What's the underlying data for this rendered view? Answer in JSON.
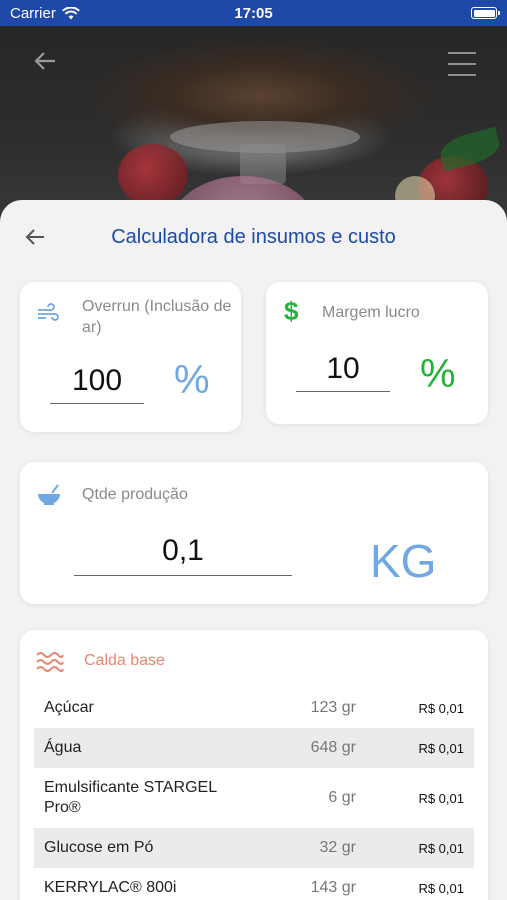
{
  "status_bar": {
    "carrier": "Carrier",
    "time": "17:05"
  },
  "header": {
    "title": "Calculadora de insumos e custo"
  },
  "overrun": {
    "label": "Overrun (Inclusão de ar)",
    "value": "100",
    "unit": "%"
  },
  "margem": {
    "icon": "$",
    "label": "Margem lucro",
    "value": "10",
    "unit": "%"
  },
  "qtde": {
    "label": "Qtde produção",
    "value": "0,1",
    "unit": "KG"
  },
  "calda": {
    "label": "Calda base",
    "items": [
      {
        "name": "Açúcar",
        "qty": "123 gr",
        "price": "R$ 0,01"
      },
      {
        "name": "Água",
        "qty": "648 gr",
        "price": "R$ 0,01"
      },
      {
        "name": "Emulsificante STARGEL Pro®",
        "qty": "6 gr",
        "price": "R$ 0,01"
      },
      {
        "name": "Glucose em Pó",
        "qty": "32 gr",
        "price": "R$ 0,01"
      },
      {
        "name": "KERRYLAC® 800i",
        "qty": "143 gr",
        "price": "R$ 0,01"
      }
    ]
  },
  "colors": {
    "primary": "#1c4aa6",
    "accent_blue": "#6fa8e2",
    "accent_green": "#21b33a",
    "accent_orange": "#e8866e"
  }
}
